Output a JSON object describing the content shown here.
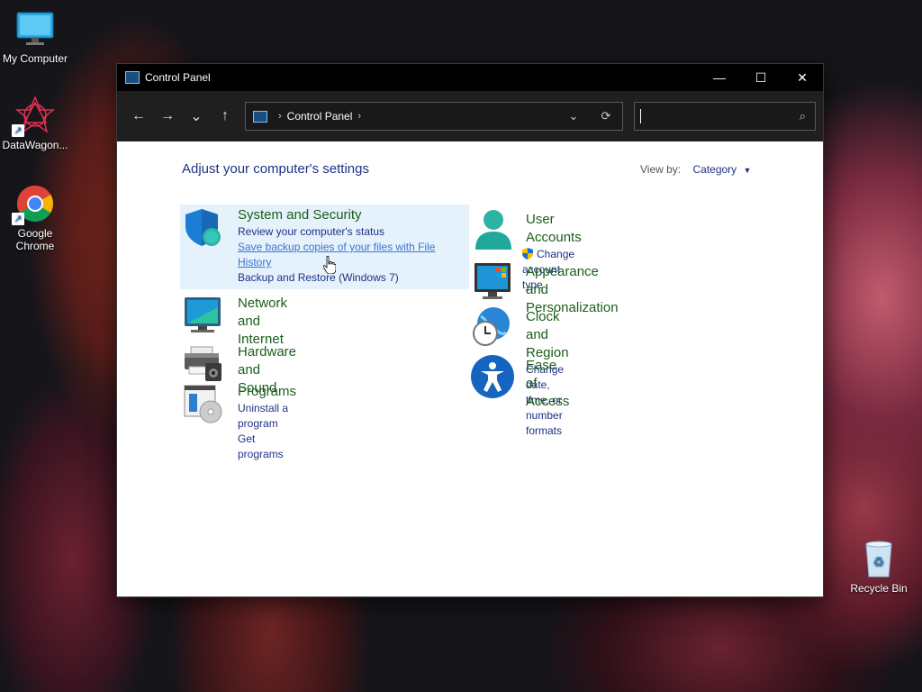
{
  "desktop": {
    "icons": [
      {
        "label": "My Computer"
      },
      {
        "label": "DataWagon..."
      },
      {
        "label": "Google Chrome"
      }
    ],
    "recycle_bin": "Recycle Bin"
  },
  "window": {
    "title": "Control Panel",
    "controls": {
      "minimize": "—",
      "maximize": "☐",
      "close": "✕"
    },
    "nav": {
      "back": "←",
      "forward": "→",
      "recent": "⌄",
      "up": "↑"
    },
    "address": {
      "crumb": "Control Panel"
    },
    "search": {
      "placeholder": ""
    }
  },
  "content": {
    "title": "Adjust your computer's settings",
    "view_by_label": "View by:",
    "view_by_value": "Category",
    "categories": [
      {
        "title": "System and Security",
        "links": [
          "Review your computer's status",
          "Save backup copies of your files with File History",
          "Backup and Restore (Windows 7)"
        ]
      },
      {
        "title": "Network and Internet",
        "links": []
      },
      {
        "title": "Hardware and Sound",
        "links": []
      },
      {
        "title": "Programs",
        "links": [
          "Uninstall a program",
          "Get programs"
        ]
      },
      {
        "title": "User Accounts",
        "links": [
          "Change account type"
        ]
      },
      {
        "title": "Appearance and Personalization",
        "links": []
      },
      {
        "title": "Clock and Region",
        "links": [
          "Change date, time, or number formats"
        ]
      },
      {
        "title": "Ease of Access",
        "links": []
      }
    ]
  }
}
